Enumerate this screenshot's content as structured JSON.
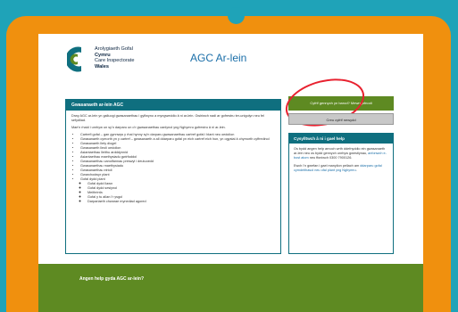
{
  "brand": {
    "name_welsh_1": "Arolygiaeth Gofal",
    "name_welsh_2": "Cymru",
    "name_english_1": "Care Inspectorate",
    "name_english_2": "Wales",
    "colors": {
      "teal": "#0f6f7f",
      "green": "#5e8a22",
      "blue": "#1a6ea8",
      "orange": "#f0900e",
      "bg": "#1fa3b8",
      "circle": "#e8212f"
    }
  },
  "header": {
    "app_title": "AGC Ar-lein"
  },
  "main": {
    "title": "Gwasanaeth ar-lein AGC",
    "para1": "Drwy AGC ar-lein yn galluogi gwasanaethau i gyflwyno a myngweddio â ni ar-lein. Gwiriwch nadi ar gofrestru ter-unigolyn neu fel sefydliad.",
    "para2": "Mae'n rhaid i unrhyw un sy'n darparu un o'r gwasanaethau canlynol yng Nghymru gofrestru â ni ar-lein.",
    "services": [
      "Cartrefi gofal – gan gynnwys y rhai hynny sy'n darparu gwasanaethau cartref gofal i blant neu oedolion",
      "Gwasanaeth cymorth yn y cartref – gwasanaeth a all ddarparu gofal yn eich cartref eich hun, yn ogystal â chymorth cyffredinol",
      "Gwasanaeth llety diogel",
      "Gwasanaeth lleoli oedolion",
      "Asiantaethau lleithu ardddynnid",
      "Asiantaethau maethysiadu gwirfoddol",
      "Gwasanaethau canolfannau preswyl i deuluoedd",
      "Gwasanaethau maethysiadu",
      "Gwasanaethau eirioli",
      "Gwarchodwyr plant",
      "Gofal dydd plant"
    ],
    "sub_services": [
      "Gofal dydd llawn",
      "Gofal dydd sesiynol",
      "Meithrinfa",
      "Gofal y tu allan i'r ysgol",
      "Darpariaeth chwarae mynediad agored"
    ]
  },
  "actions": {
    "primary_label": "Cyfrif gennych yn barod? Mewngofnodi",
    "secondary_label": "Creu cyfrif newydd"
  },
  "help": {
    "title": "Cysylltwch â ni i gael help",
    "para1_pre": "Os bydd angen help arnoch wrth ddefnyddio ein gwasanaeth ar-lein neu os bydd gennych unrhyw gwestiynau,",
    "para1_link": "anfonwch e-bost atom",
    "para1_post": "neu ffoniwch 0300 7900126.",
    "para2_pre": "Ewch i'n gwefan i gael manylion pellach am",
    "para2_link": "ddarparu gofal cymdeithasol neu ofal plant yng Nghymru",
    "para2_post": "."
  },
  "footer": {
    "text": "Angen help gyda AGC ar-lein?"
  }
}
